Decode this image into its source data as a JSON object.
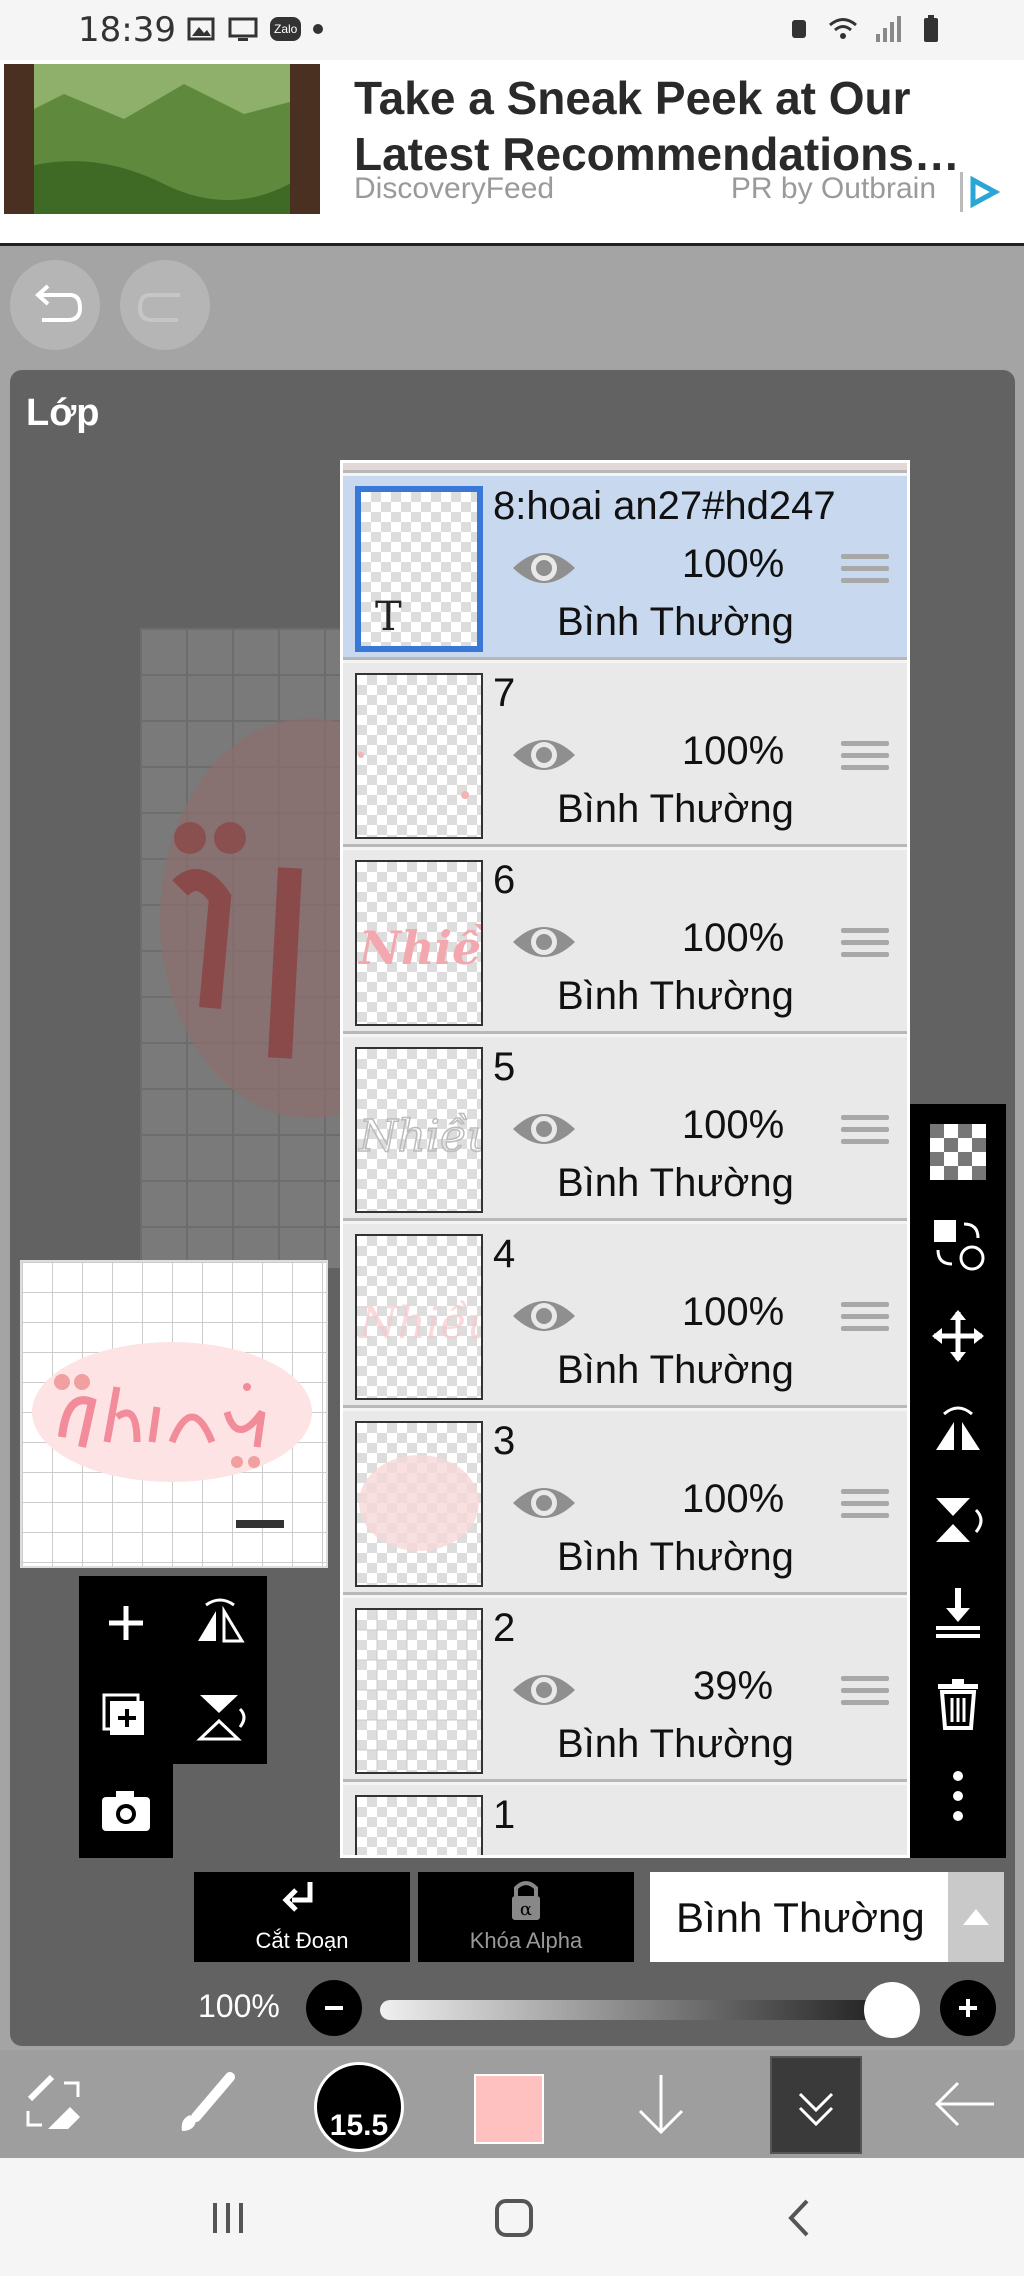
{
  "status_bar": {
    "time": "18:39",
    "left_icons": [
      "gallery-icon",
      "screen-cast-icon",
      "zalo-icon"
    ],
    "zalo_label": "Zalo",
    "right_icons": [
      "alarm-icon",
      "wifi-icon",
      "signal-icon",
      "battery-icon"
    ]
  },
  "ad": {
    "title": "Take a Sneak Peek at Our Latest Recommendations…",
    "source": "DiscoveryFeed",
    "pr": "PR by Outbrain"
  },
  "panel": {
    "title": "Lớp"
  },
  "layers": [
    {
      "name": "8:hoai an27#hd247",
      "opacity": "100%",
      "blend": "Bình Thường",
      "selected": true
    },
    {
      "name": "7",
      "opacity": "100%",
      "blend": "Bình Thường",
      "selected": false
    },
    {
      "name": "6",
      "opacity": "100%",
      "blend": "Bình Thường",
      "selected": false
    },
    {
      "name": "5",
      "opacity": "100%",
      "blend": "Bình Thường",
      "selected": false
    },
    {
      "name": "4",
      "opacity": "100%",
      "blend": "Bình Thường",
      "selected": false
    },
    {
      "name": "3",
      "opacity": "100%",
      "blend": "Bình Thường",
      "selected": false
    },
    {
      "name": "2",
      "opacity": "39%",
      "blend": "Bình Thường",
      "selected": false
    },
    {
      "name": "1",
      "opacity": "",
      "blend": "",
      "selected": false
    }
  ],
  "layer_thumb_text_marker": "T",
  "actions": {
    "clip_label": "Cắt Đoạn",
    "alpha_lock_label": "Khóa Alpha",
    "blend_mode": "Bình Thường"
  },
  "opacity_control": {
    "label": "100%",
    "value": 1.0
  },
  "brush_size": "15.5",
  "colors": {
    "current_color": "#ffc0c0",
    "selected_layer_bg": "#c8d8ef",
    "selected_border": "#3a78d8"
  }
}
